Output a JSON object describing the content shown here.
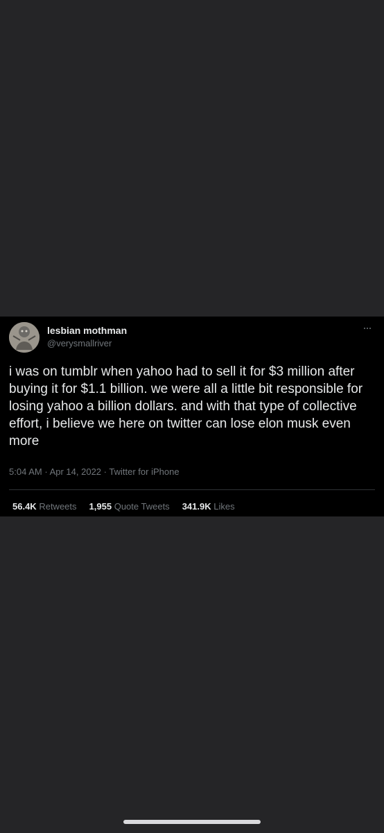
{
  "tweet": {
    "author": {
      "display_name": "lesbian mothman",
      "handle": "@verysmallriver"
    },
    "text": "i was on tumblr when yahoo had to sell it for $3 million after buying it for $1.1 billion. we were all a little bit responsible for losing yahoo a billion dollars. and with that type of collective effort, i believe we here on twitter can lose elon musk even more",
    "time": "5:04 AM",
    "date": "Apr 14, 2022",
    "source": "Twitter for iPhone",
    "separator": "·",
    "stats": {
      "retweets_count": "56.4K",
      "retweets_label": "Retweets",
      "quotes_count": "1,955",
      "quotes_label": "Quote Tweets",
      "likes_count": "341.9K",
      "likes_label": "Likes"
    }
  },
  "colors": {
    "page_background": "#252527",
    "card_background": "#000000",
    "primary_text": "#e7e9ea",
    "secondary_text": "#71767b"
  }
}
